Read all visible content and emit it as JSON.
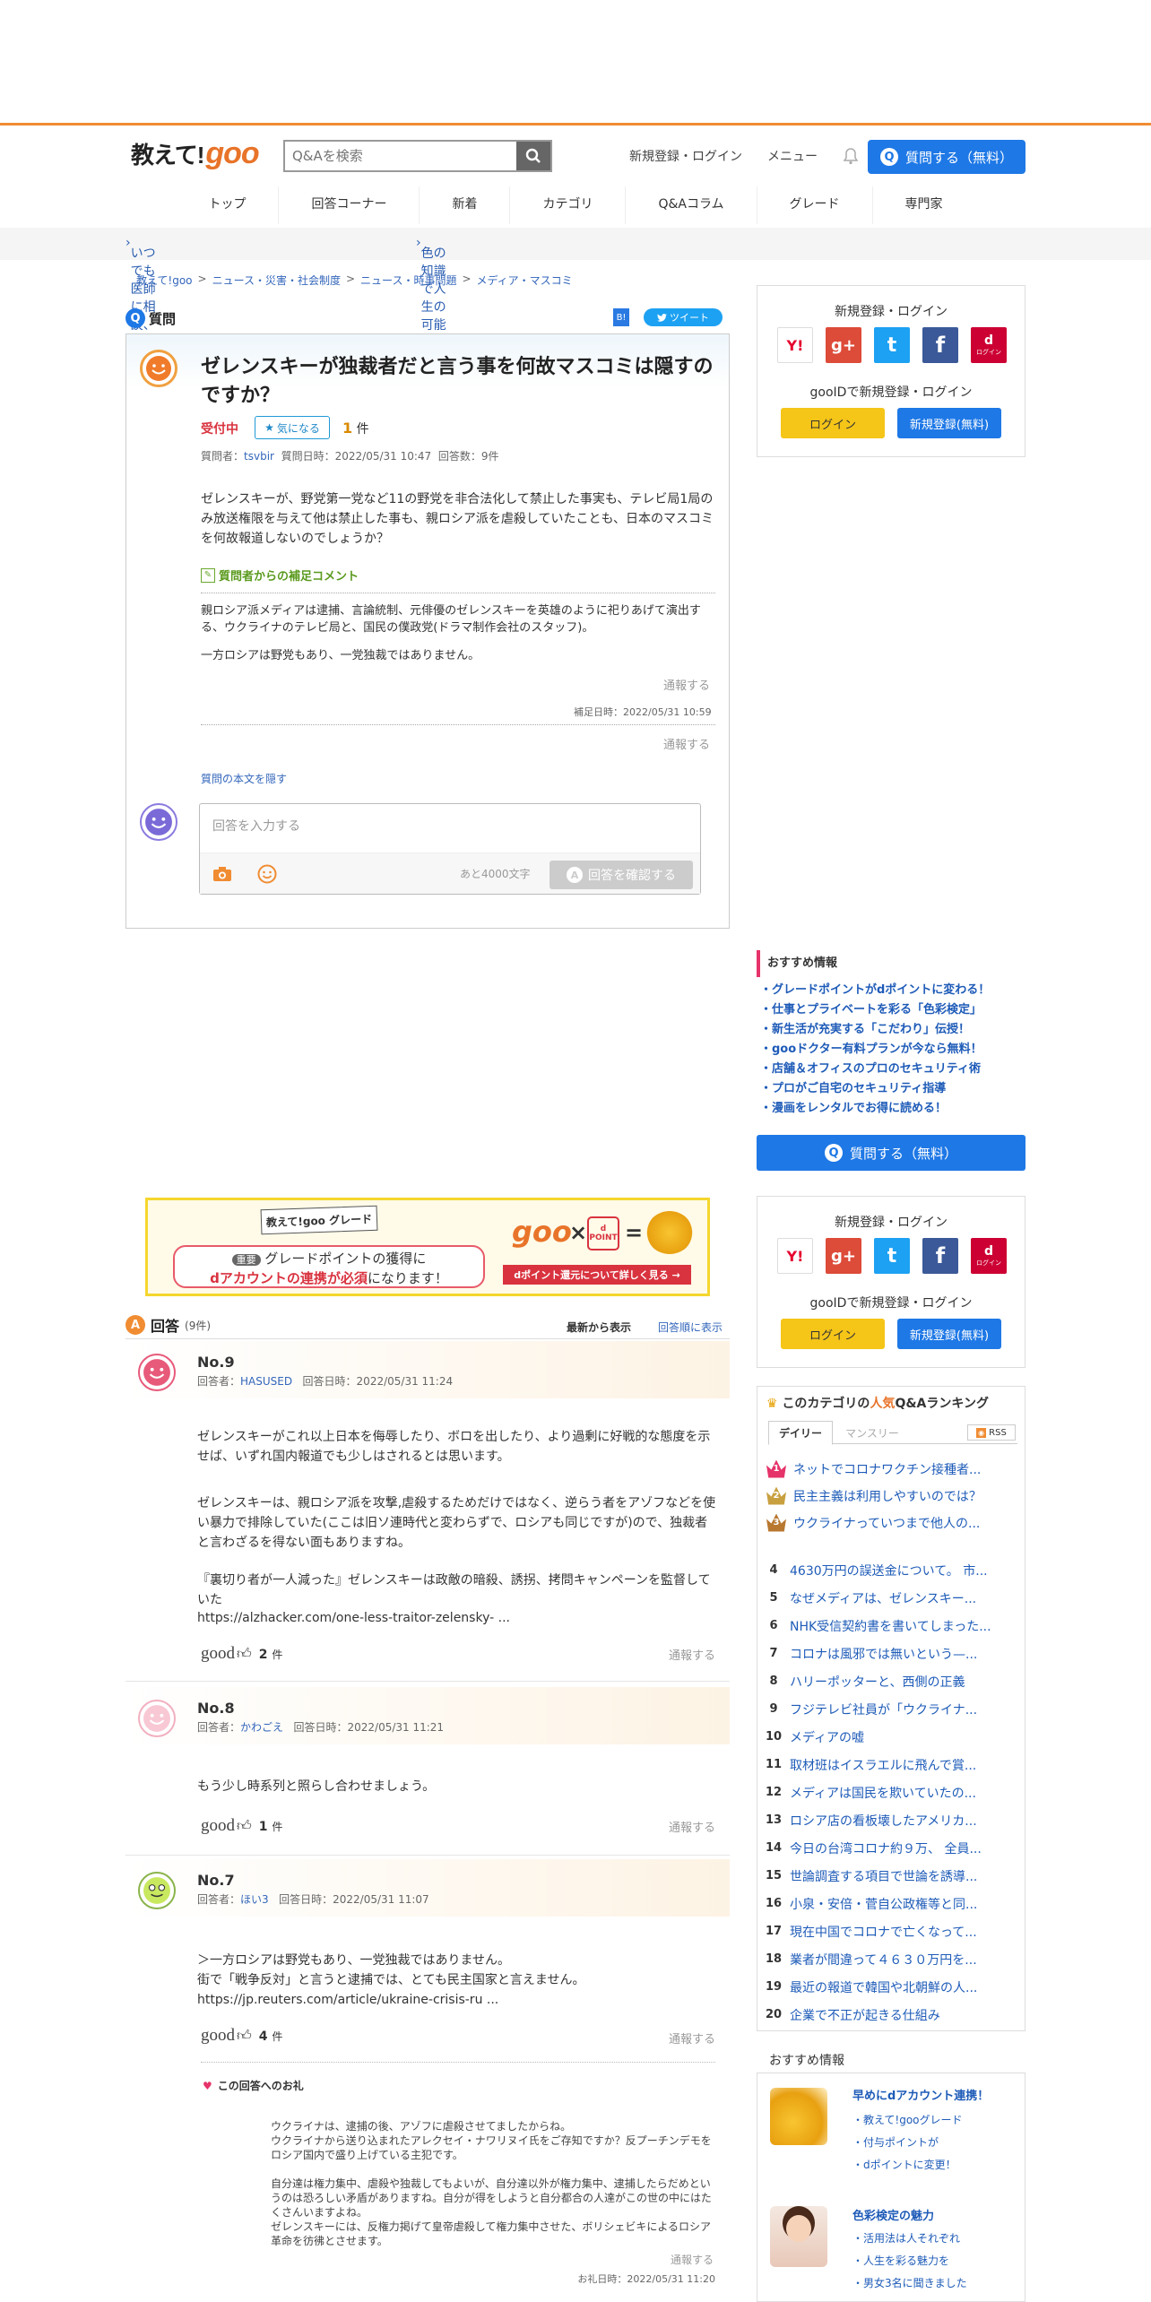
{
  "header": {
    "logo_text": "教えて!",
    "logo_goo": "goo",
    "search_placeholder": "Q&Aを検索",
    "login_link": "新規登録・ログイン",
    "menu_link": "メニュー",
    "ask_button": "質問する（無料）"
  },
  "nav": [
    "トップ",
    "回答コーナー",
    "新着",
    "カテゴリ",
    "Q&Aコラム",
    "グレード",
    "専門家"
  ],
  "promo": {
    "left": "いつでも医師に相談、gooドクター",
    "right": "色の知識で人生の可能性が広がる！みんなに役立つ色彩検定 >>"
  },
  "breadcrumb": [
    "教えて!goo",
    "ニュース・災害・社会制度",
    "ニュース・時事問題",
    "メディア・マスコミ"
  ],
  "question": {
    "section_label": "質問",
    "tweet": "ツイート",
    "bookmark": "B!",
    "title": "ゼレンスキーが独裁者だと言う事を何故マスコミは隠すのですか？",
    "status": "受付中",
    "kininaru": "気になる",
    "kininaru_count": "1",
    "kininaru_unit": "件",
    "meta_prefix": "質問者：",
    "asker": "tsvbir",
    "meta_date": "質問日時：2022/05/31 10:47",
    "meta_count": "回答数：9件",
    "body": "ゼレンスキーが、野党第一党など11の野党を非合法化して禁止した事実も、テレビ局1局のみ放送権限を与えて他は禁止した事も、親ロシア派を虐殺していたことも、日本のマスコミを何故報道しないのでしょうか？",
    "supplement_label": "質問者からの補足コメント",
    "supplement_1": "親ロシア派メディアは逮捕、言論統制、元俳優のゼレンスキーを英雄のように祀りあげて演出する、ウクライナのテレビ局と、国民の僕政党(ドラマ制作会社のスタッフ)。",
    "supplement_2": "一方ロシアは野党もあり、一党独裁ではありません。",
    "report": "通報する",
    "supplement_date": "補足日時：2022/05/31 10:59",
    "report2": "通報する",
    "hide_body": "質問の本文を隠す",
    "answer_placeholder": "回答を入力する",
    "chars_left": "あと4000文字",
    "confirm": "回答を確認する"
  },
  "sidebar": {
    "login_title": "新規登録・ログイン",
    "goo_id": "gooIDで新規登録・ログイン",
    "login_btn": "ログイン",
    "register_btn": "新規登録(無料)",
    "sns": [
      "Y!",
      "g+",
      "t",
      "f",
      "d"
    ],
    "sns_d_label": "ログイン",
    "rec_title": "おすすめ情報",
    "rec_items": [
      "・グレードポイントがdポイントに変わる！",
      "・仕事とプライベートを彩る「色彩検定」",
      "・新生活が充実する「こだわり」伝授！",
      "・gooドクター有料プランが今なら無料！",
      "・店舗＆オフィスのプロのセキュリティ術",
      "・プロがご自宅のセキュリティ指導",
      "・漫画をレンタルでお得に読める！"
    ],
    "ask_button": "質問する（無料）",
    "ranking_title_pre": "このカテゴリの",
    "ranking_title_hl": "人気",
    "ranking_title_post": "Q&Aランキング",
    "tab_daily": "デイリー",
    "tab_monthly": "マンスリー",
    "rss": "RSS",
    "ranking": [
      "ネットでコロナワクチン接種者...",
      "民主主義は利用しやすいのでは？",
      "ウクライナっていつまで他人の...",
      "4630万円の誤送金について。 市...",
      "なぜメディアは、ゼレンスキー...",
      "NHK受信契約書を書いてしまった...",
      "コロナは風邪では無いという—...",
      "ハリーポッターと、西側の正義",
      "フジテレビ社員が「ウクライナ...",
      "メディアの嘘",
      "取材班はイスラエルに飛んで賞...",
      "メディアは国民を欺いていたの...",
      "ロシア店の看板壊したアメリカ...",
      "今日の台湾コロナ約９万、 全員...",
      "世論調査する項目で世論を誘導...",
      "小泉・安倍・菅自公政権等と同...",
      "現在中国でコロナで亡くなって...",
      "業者が間違って４６３０万円を...",
      "最近の報道で韓国や北朝鮮の人...",
      "企業で不正が起きる仕組み"
    ],
    "rec2_title": "おすすめ情報",
    "rec2_a_title": "早めにdアカウント連携！",
    "rec2_a_items": [
      "教えて!gooグレード",
      "付与ポイントが",
      "dポイントに変更！"
    ],
    "rec2_b_title": "色彩検定の魅力",
    "rec2_b_items": [
      "活用法は人それぞれ",
      "人生を彩る魅力を",
      "男女3名に聞きました"
    ]
  },
  "banner": {
    "ribbon": "教えて!goo グレード",
    "tag": "重要",
    "line1": "グレードポイントの獲得に",
    "line2a": "dアカウントの連携が必須",
    "line2b": "になります！",
    "goo": "goo",
    "times": "×",
    "equals": "=",
    "dpoint": "d POINT",
    "cta": "dポイント還元について詳しく見る →"
  },
  "answers_header": {
    "label": "回答",
    "count": "(9件)",
    "sort_new": "最新から表示",
    "sort_old": "回答順に表示"
  },
  "answers": [
    {
      "no": "No.9",
      "answerer_prefix": "回答者：",
      "answerer": "HASUSED",
      "date": "回答日時：2022/05/31 11:24",
      "p1": "ゼレンスキーがこれ以上日本を侮辱したり、ボロを出したり、より過剰に好戦的な態度を示せば、いずれ国内報道でも少しはされるとは思います。",
      "p2": "ゼレンスキーは、親ロシア派を攻撃,虐殺するためだけではなく、逆らう者をアゾフなどを使い暴力で排除していた(ここは旧ソ連時代と変わらずで、ロシアも同じですが)ので、独裁者と言わざるを得ない面もありますね。",
      "p3": "『裏切り者が一人減った』ゼレンスキーは政敵の暗殺、誘拐、拷問キャンペーンを監督していた",
      "link": "https://alzhacker.com/one-less-traitor-zelensky- ...",
      "good": "good",
      "good_count": "2",
      "good_unit": "件",
      "report": "通報する"
    },
    {
      "no": "No.8",
      "answerer_prefix": "回答者：",
      "answerer": "かわごえ",
      "date": "回答日時：2022/05/31 11:21",
      "p1": "もう少し時系列と照らし合わせましょう。",
      "good": "good",
      "good_count": "1",
      "good_unit": "件",
      "report": "通報する"
    },
    {
      "no": "No.7",
      "answerer_prefix": "回答者：",
      "answerer": "ほい3",
      "date": "回答日時：2022/05/31 11:07",
      "p1": "＞一方ロシアは野党もあり、一党独裁ではありません。",
      "p2": "街で「戦争反対」と言うと逮捕では、とても民主国家と言えません。",
      "link": "https://jp.reuters.com/article/ukraine-crisis-ru ...",
      "good": "good",
      "good_count": "4",
      "good_unit": "件",
      "report": "通報する"
    }
  ],
  "thanks": {
    "title": "この回答へのお礼",
    "p1": "ウクライナは、逮捕の後、アゾフに虐殺させてましたからね。",
    "p2": "ウクライナから送り込まれたアレクセイ・ナワリヌイ氏をご存知ですか？反プーチンデモをロシア国内で盛り上げている主犯です。",
    "p3": "自分達は権力集中、虐殺や独裁してもよいが、自分達以外が権力集中、逮捕したらだめというのは恐ろしい矛盾がありますね。自分が得をしようと自分都合の人達がこの世の中にはたくさんいますよね。",
    "p4": "ゼレンスキーには、反権力掲げて皇帝虐殺して権力集中させた、ボリシェビキによるロシア革命を彷彿とさせます。",
    "report": "通報する",
    "date": "お礼日時：2022/05/31 11:20"
  },
  "colors": {
    "accent": "#f08c32",
    "primary": "#1e78e6",
    "red": "#d9333f",
    "link": "#3366bb"
  }
}
